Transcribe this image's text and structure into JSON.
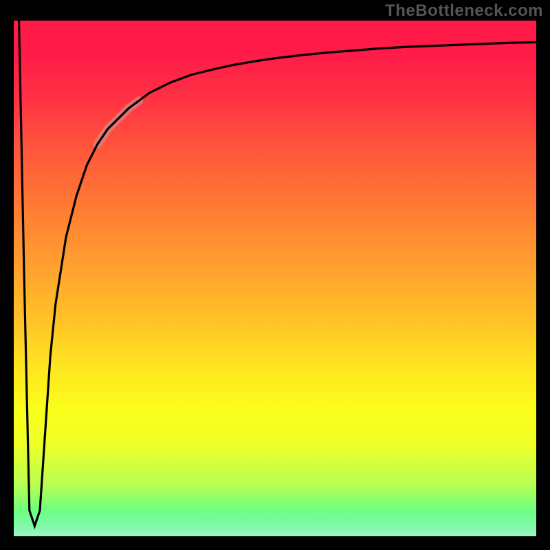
{
  "watermark": "TheBottleneck.com",
  "colors": {
    "frame_bg": "#000000",
    "curve": "#000000",
    "highlight": "rgba(200,160,160,0.55)",
    "gradient_css": "linear-gradient(to bottom, #ff1a48 0%, #ff1a48 6%, #ff2e44 14%, #ff5a3a 26%, #ff7a34 36%, #ffa22e 48%, #ffc227 58%, #ffe81f 68%, #f9ff1a 76%, #efff26 82%, #b8ff52 90%, #6dff80 95%, #22f07a 100%)"
  },
  "chart_data": {
    "type": "line",
    "title": "",
    "xlabel": "",
    "ylabel": "",
    "xlim": [
      0,
      100
    ],
    "ylim": [
      0,
      100
    ],
    "note": "x/y are percent of plot area; values estimated visually from the curve",
    "series": [
      {
        "name": "bottleneck-curve",
        "x": [
          1,
          2,
          3,
          4,
          5,
          6,
          7,
          8,
          10,
          12,
          14,
          16,
          18,
          20,
          22,
          24,
          26,
          28,
          30,
          34,
          38,
          42,
          46,
          50,
          55,
          60,
          65,
          70,
          75,
          80,
          85,
          90,
          95,
          100
        ],
        "y": [
          100,
          50,
          5,
          2,
          5,
          20,
          35,
          45,
          58,
          66,
          72,
          76,
          79,
          81,
          83,
          84.5,
          86,
          87,
          88,
          89.5,
          90.5,
          91.4,
          92.1,
          92.7,
          93.3,
          93.8,
          94.2,
          94.6,
          94.9,
          95.1,
          95.3,
          95.5,
          95.7,
          95.8
        ]
      },
      {
        "name": "highlight-segment",
        "x": [
          16,
          18,
          20,
          22,
          24
        ],
        "y": [
          76,
          79,
          81,
          83,
          84.5
        ]
      }
    ]
  }
}
